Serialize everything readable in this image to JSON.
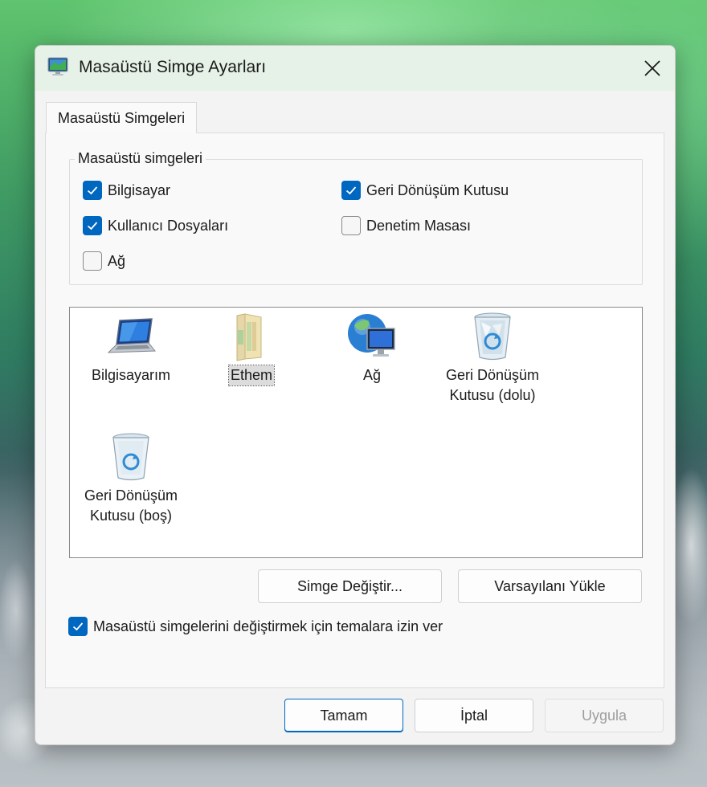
{
  "window": {
    "title": "Masaüstü Simge Ayarları"
  },
  "tab": {
    "label": "Masaüstü Simgeleri"
  },
  "group": {
    "legend": "Masaüstü simgeleri",
    "checkboxes": [
      {
        "label": "Bilgisayar",
        "checked": true
      },
      {
        "label": "Geri Dönüşüm Kutusu",
        "checked": true
      },
      {
        "label": "Kullanıcı Dosyaları",
        "checked": true
      },
      {
        "label": "Denetim Masası",
        "checked": false
      },
      {
        "label": "Ağ",
        "checked": false
      }
    ]
  },
  "icons": [
    {
      "label": "Bilgisayarım",
      "icon": "laptop-icon"
    },
    {
      "label": "Ethem",
      "icon": "user-folder-icon",
      "selected": true
    },
    {
      "label": "Ağ",
      "icon": "network-globe-icon"
    },
    {
      "label1": "Geri Dönüşüm",
      "label2": "Kutusu (dolu)",
      "icon": "recycle-bin-full-icon"
    },
    {
      "label1": "Geri Dönüşüm",
      "label2": "Kutusu (boş)",
      "icon": "recycle-bin-empty-icon"
    }
  ],
  "actions": {
    "change_icon": "Simge Değiştir...",
    "restore_default": "Varsayılanı Yükle"
  },
  "theme_option": {
    "label": "Masaüstü simgelerini değiştirmek için temalara izin ver",
    "checked": true
  },
  "footer": {
    "ok": "Tamam",
    "cancel": "İptal",
    "apply": "Uygula"
  },
  "colors": {
    "accent": "#0067c0",
    "titlebar": "#e6f2e7"
  }
}
